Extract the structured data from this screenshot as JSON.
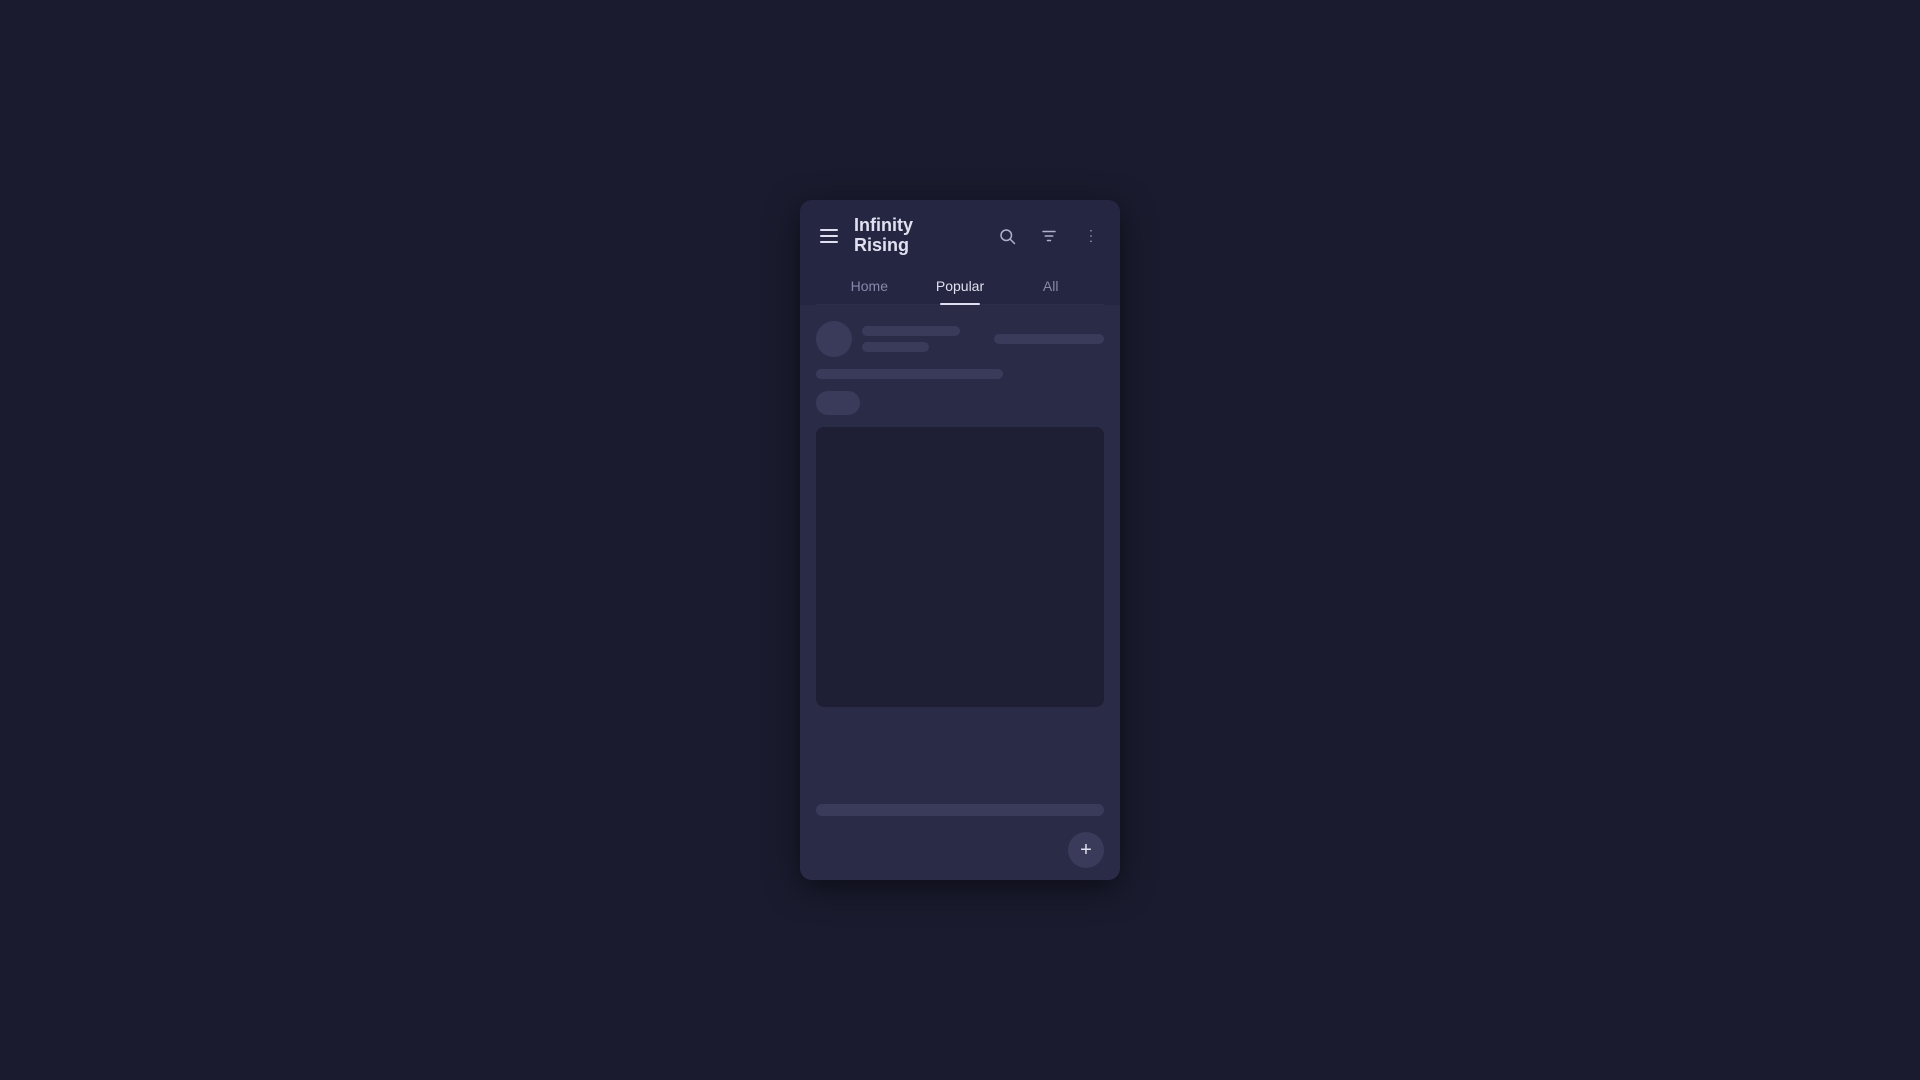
{
  "header": {
    "title_line1": "Infinity",
    "title_line2": "Rising",
    "menu_label": "menu",
    "search_label": "search",
    "filter_label": "filter",
    "more_label": "more options"
  },
  "tabs": [
    {
      "label": "Home",
      "active": false
    },
    {
      "label": "Popular",
      "active": true
    },
    {
      "label": "All",
      "active": false
    }
  ],
  "fab": {
    "label": "+"
  }
}
